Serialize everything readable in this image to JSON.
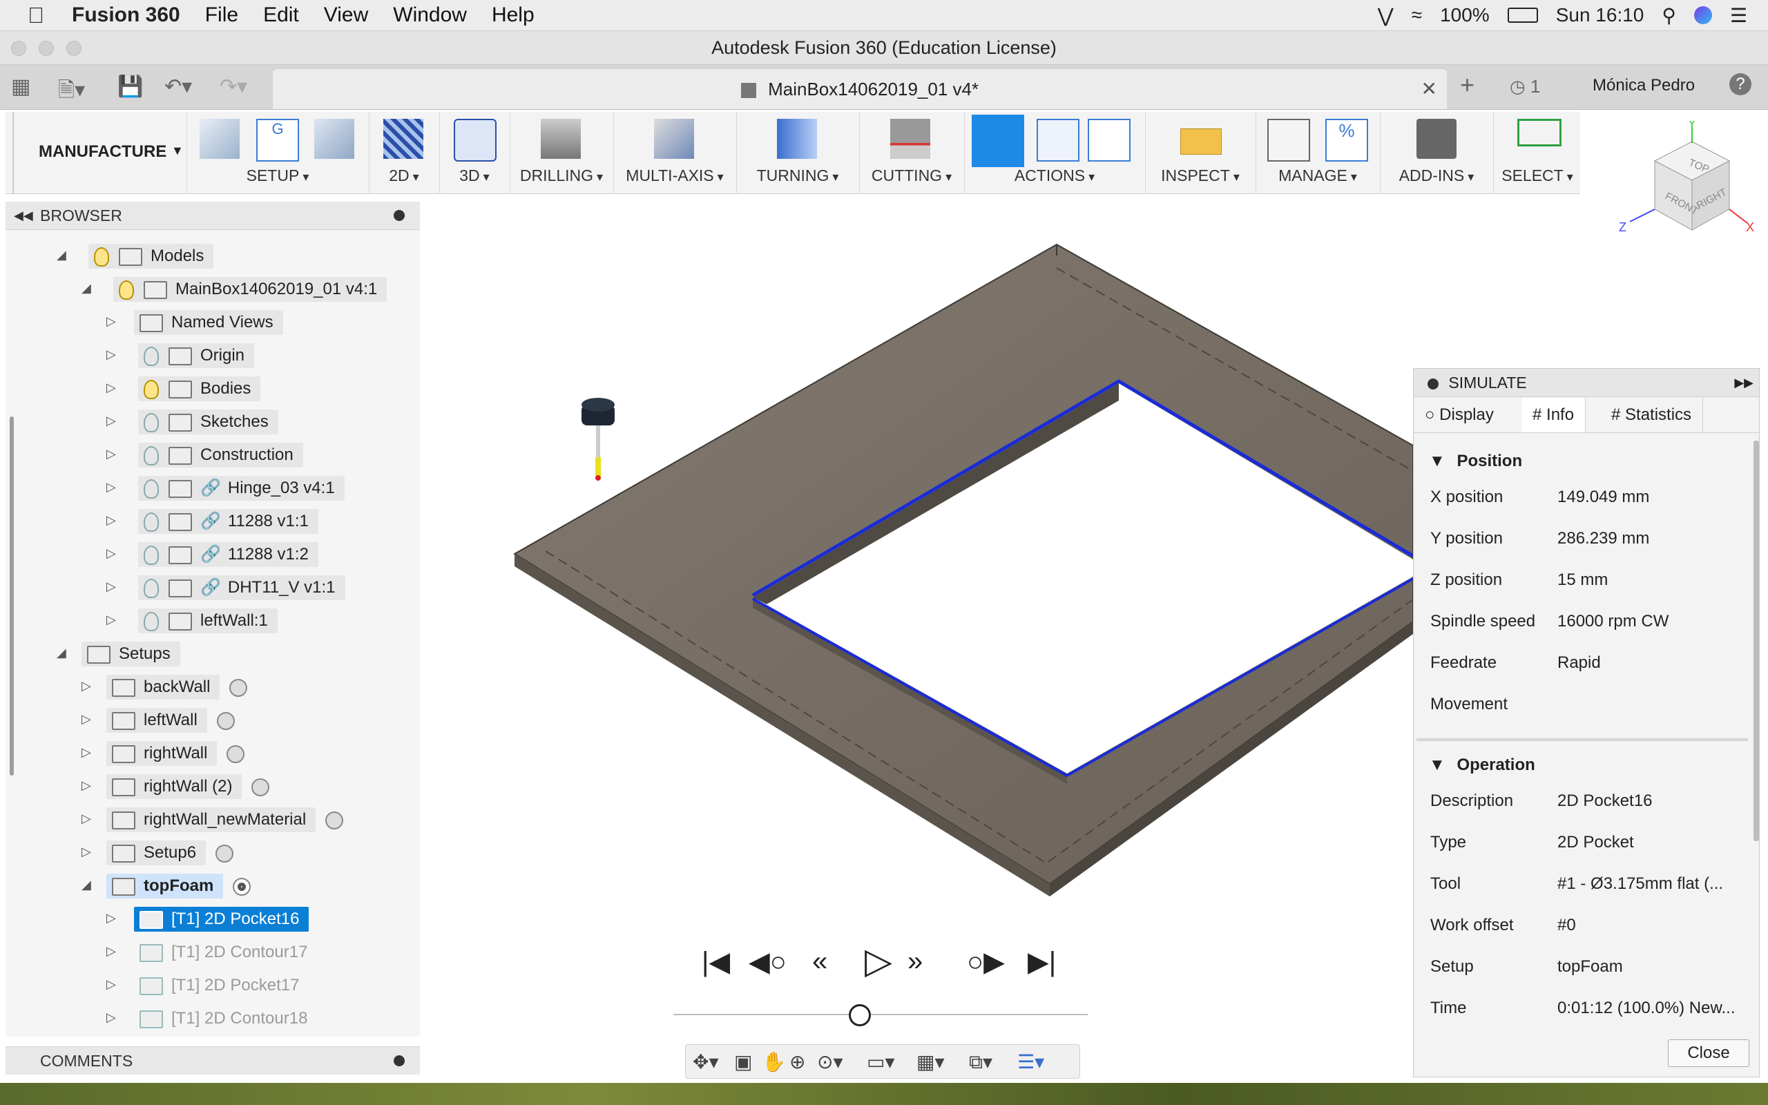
{
  "menubar": {
    "app": "Fusion 360",
    "items": [
      "File",
      "Edit",
      "View",
      "Window",
      "Help"
    ],
    "battery": "100%",
    "clock": "Sun 16:10"
  },
  "window": {
    "title": "Autodesk Fusion 360 (Education License)"
  },
  "tabstrip": {
    "doc_tab": "MainBox14062019_01 v4*",
    "jobs": "1",
    "user": "Mónica Pedro",
    "help": "?"
  },
  "toolbar": {
    "workspace": "MANUFACTURE",
    "groups": [
      "SETUP",
      "2D",
      "3D",
      "DRILLING",
      "MULTI-AXIS",
      "TURNING",
      "CUTTING",
      "ACTIONS",
      "INSPECT",
      "MANAGE",
      "ADD-INS",
      "SELECT"
    ]
  },
  "browser": {
    "title": "BROWSER",
    "models": "Models",
    "component": "MainBox14062019_01 v4:1",
    "model_items": [
      "Named Views",
      "Origin",
      "Bodies",
      "Sketches",
      "Construction",
      "Hinge_03 v4:1",
      "11288 v1:1",
      "11288 v1:2",
      "DHT11_V v1:1",
      "leftWall:1"
    ],
    "setups": "Setups",
    "setup_items": [
      "backWall",
      "leftWall",
      "rightWall",
      "rightWall (2)",
      "rightWall_newMaterial",
      "Setup6",
      "topFoam"
    ],
    "ops": [
      "[T1] 2D Pocket16",
      "[T1] 2D Contour17",
      "[T1] 2D Pocket17",
      "[T1] 2D Contour18"
    ]
  },
  "comments": {
    "title": "COMMENTS"
  },
  "viewcube": {
    "top": "TOP",
    "front": "FRONT",
    "right": "RIGHT",
    "axis_x": "X",
    "axis_y": "Y",
    "axis_z": "Z"
  },
  "simulate": {
    "title": "SIMULATE",
    "tabs": [
      "Display",
      "Info",
      "Statistics"
    ],
    "position_title": "Position",
    "position": [
      {
        "k": "X position",
        "v": "149.049 mm"
      },
      {
        "k": "Y position",
        "v": "286.239 mm"
      },
      {
        "k": "Z position",
        "v": "15 mm"
      },
      {
        "k": "Spindle speed",
        "v": "16000 rpm CW"
      },
      {
        "k": "Feedrate",
        "v": "Rapid"
      },
      {
        "k": "Movement",
        "v": ""
      }
    ],
    "operation_title": "Operation",
    "operation": [
      {
        "k": "Description",
        "v": "2D Pocket16"
      },
      {
        "k": "Type",
        "v": "2D Pocket"
      },
      {
        "k": "Tool",
        "v": "#1 - Ø3.175mm flat (..."
      },
      {
        "k": "Work offset",
        "v": "#0"
      },
      {
        "k": "Setup",
        "v": "topFoam"
      },
      {
        "k": "Time",
        "v": "0:01:12 (100.0%) New..."
      }
    ],
    "close": "Close"
  },
  "playback": {
    "slider_position": 0.45
  }
}
